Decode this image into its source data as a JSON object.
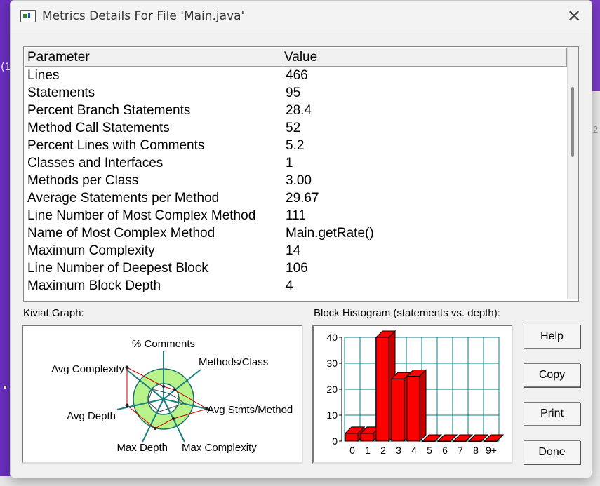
{
  "window": {
    "title": "Metrics Details For File 'Main.java'",
    "close_glyph": "✕"
  },
  "table": {
    "headers": [
      "Parameter",
      "Value"
    ],
    "rows": [
      [
        "Lines",
        "466"
      ],
      [
        "Statements",
        "95"
      ],
      [
        "Percent Branch Statements",
        "28.4"
      ],
      [
        "Method Call Statements",
        "52"
      ],
      [
        "Percent Lines with Comments",
        "5.2"
      ],
      [
        "Classes and Interfaces",
        "1"
      ],
      [
        "Methods per Class",
        "3.00"
      ],
      [
        "Average Statements per Method",
        "29.67"
      ],
      [
        "Line Number of Most Complex Method",
        "111"
      ],
      [
        "Name of Most Complex Method",
        "Main.getRate()"
      ],
      [
        "Maximum Complexity",
        "14"
      ],
      [
        "Line Number of Deepest Block",
        "106"
      ],
      [
        "Maximum Block Depth",
        "4"
      ]
    ]
  },
  "kiviat": {
    "title": "Kiviat Graph:",
    "axes": [
      "% Comments",
      "Methods/Class",
      "Avg Stmts/Method",
      "Max Complexity",
      "Max Depth",
      "Avg Depth",
      "Avg Complexity"
    ]
  },
  "histogram": {
    "title": "Block Histogram (statements vs. depth):",
    "y_ticks": [
      "40",
      "30",
      "20",
      "10",
      "0"
    ],
    "categories": [
      "0",
      "1",
      "2",
      "3",
      "4",
      "5",
      "6",
      "7",
      "8",
      "9+"
    ],
    "values": [
      3,
      3,
      40,
      24,
      25,
      0,
      0,
      0,
      0,
      0
    ],
    "ylim": [
      0,
      40
    ],
    "bar_color": "#ff0000",
    "grid_color": "#008080"
  },
  "buttons": {
    "help": "Help",
    "copy": "Copy",
    "print": "Print",
    "done": "Done"
  },
  "background": {
    "paren": "(1",
    "right_tab": "2"
  }
}
